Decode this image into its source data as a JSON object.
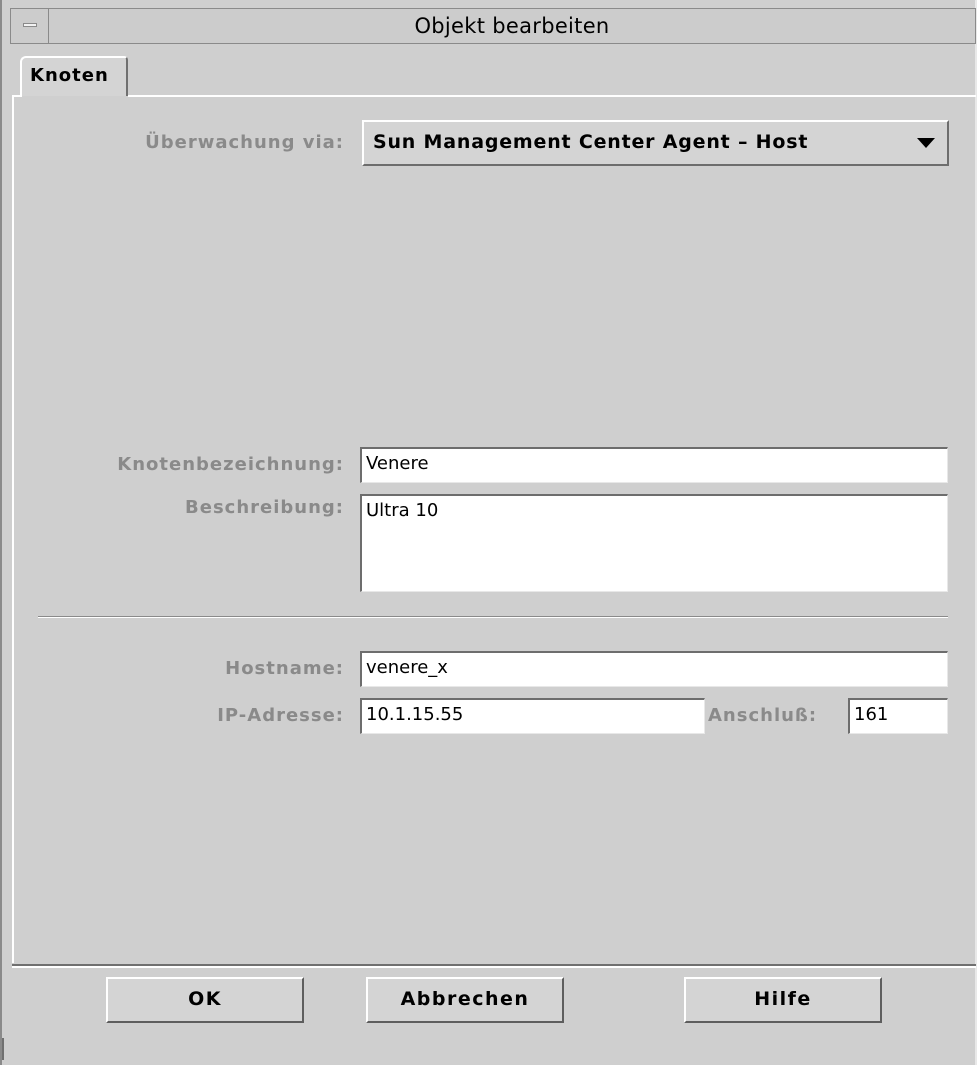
{
  "window": {
    "title": "Objekt bearbeiten"
  },
  "tabs": [
    {
      "label": "Knoten",
      "selected": true
    }
  ],
  "monitoring": {
    "label": "Überwachung via:",
    "selected": "Sun Management Center Agent – Host",
    "arrow_icon": "chevron-down-icon"
  },
  "node": {
    "name_label": "Knotenbezeichnung:",
    "name_value": "Venere",
    "description_label": "Beschreibung:",
    "description_value": "Ultra 10"
  },
  "network": {
    "hostname_label": "Hostname:",
    "hostname_value": "venere_x",
    "ip_label": "IP-Adresse:",
    "ip_value": "10.1.15.55",
    "port_label": "Anschluß:",
    "port_value": "161"
  },
  "buttons": {
    "ok": "OK",
    "cancel": "Abbrechen",
    "help": "Hilfe"
  },
  "colors": {
    "window_bg": "#cfcfcf",
    "label_gray": "#8a8a8a",
    "field_bg": "#ffffff"
  }
}
